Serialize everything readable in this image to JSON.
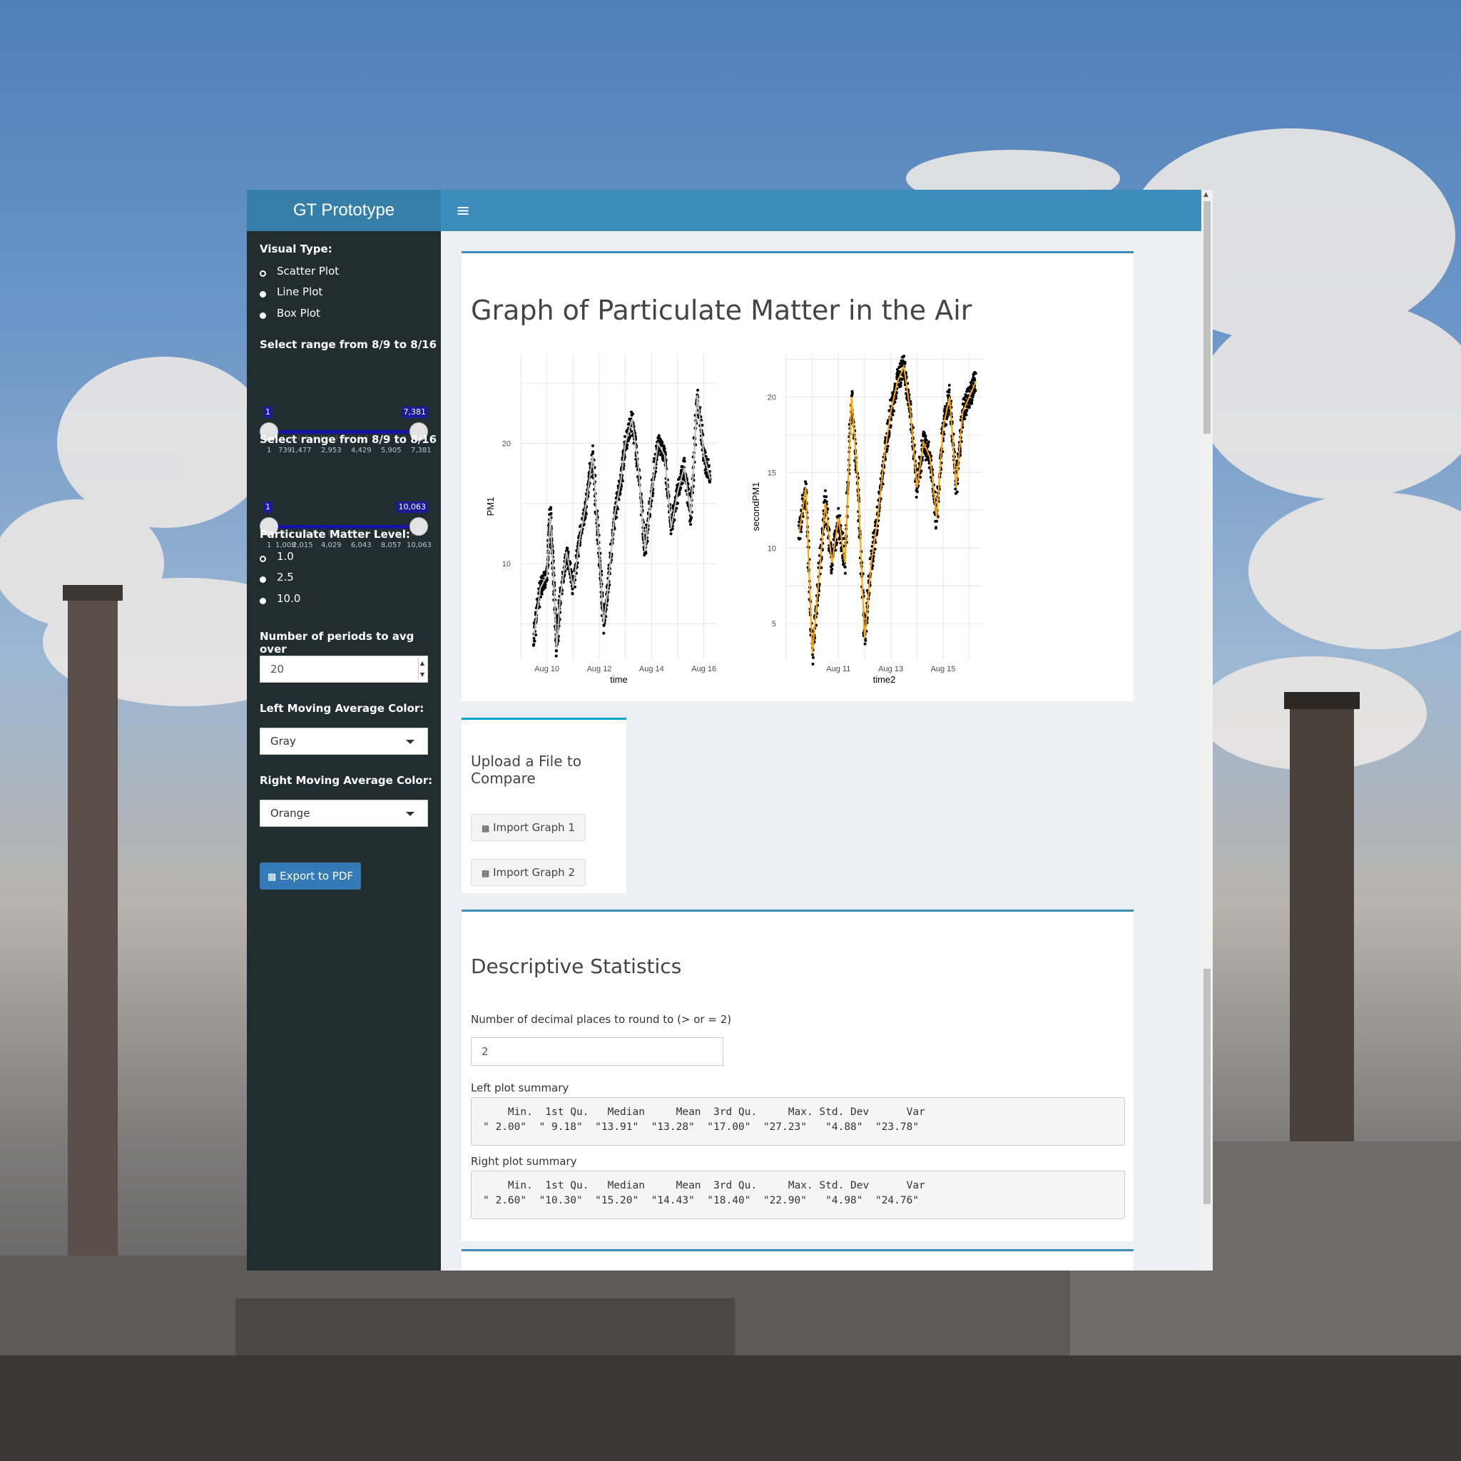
{
  "header": {
    "app_title": "GT Prototype",
    "menu_icon": "hamburger-icon"
  },
  "sidebar": {
    "visual_type": {
      "label": "Visual Type:",
      "options": [
        "Scatter Plot",
        "Line Plot",
        "Box Plot"
      ],
      "selected": "Scatter Plot"
    },
    "range1": {
      "label": "Select range from 8/9 to 8/16",
      "min_value": "1",
      "max_value": "7,381",
      "tick_labels": [
        "1",
        "739",
        "1,477",
        "2,953",
        "4,429",
        "5,905",
        "7,381"
      ]
    },
    "range2": {
      "label": "Select range from 8/9 to 8/16",
      "min_value": "1",
      "max_value": "10,063",
      "tick_labels": [
        "1",
        "1,008",
        "2,015",
        "4,029",
        "6,043",
        "8,057",
        "10,063"
      ]
    },
    "pm_level": {
      "label": "Particulate Matter Level:",
      "options": [
        "1.0",
        "2.5",
        "10.0"
      ],
      "selected": "1.0"
    },
    "periods": {
      "label": "Number of periods to avg over",
      "value": "20"
    },
    "left_color": {
      "label": "Left Moving Average Color:",
      "value": "Gray"
    },
    "right_color": {
      "label": "Right Moving Average Color:",
      "value": "Orange"
    },
    "export_button": "Export to PDF"
  },
  "graph_box": {
    "title": "Graph of Particulate Matter in the Air"
  },
  "chart_data": [
    {
      "type": "scatter",
      "title": "",
      "xlabel": "time",
      "ylabel": "PM1",
      "x_ticks": [
        "Aug 10",
        "Aug 12",
        "Aug 14",
        "Aug 16"
      ],
      "y_ticks": [
        10,
        20
      ],
      "xlim": [
        "2021-08-09",
        "2021-08-16"
      ],
      "ylim": [
        2,
        27.5
      ],
      "grid": true,
      "point_color": "#000000",
      "moving_average_color": "#bebebe",
      "series": [
        {
          "x": [
            "2021-08-09 12:00",
            "2021-08-09 18:00",
            "2021-08-10 00:00",
            "2021-08-10 03:00",
            "2021-08-10 06:00",
            "2021-08-10 09:00",
            "2021-08-10 12:00",
            "2021-08-10 18:00",
            "2021-08-11 00:00",
            "2021-08-11 06:00",
            "2021-08-11 12:00",
            "2021-08-11 18:00",
            "2021-08-12 00:00",
            "2021-08-12 04:00",
            "2021-08-12 08:00",
            "2021-08-12 14:00",
            "2021-08-12 20:00",
            "2021-08-13 00:00",
            "2021-08-13 06:00",
            "2021-08-13 12:00",
            "2021-08-13 18:00",
            "2021-08-14 00:00",
            "2021-08-14 06:00",
            "2021-08-14 12:00",
            "2021-08-14 18:00",
            "2021-08-15 00:00",
            "2021-08-15 06:00",
            "2021-08-15 12:00",
            "2021-08-15 18:00",
            "2021-08-16 00:00",
            "2021-08-16 06:00"
          ],
          "y": [
            4,
            8,
            9,
            14,
            9,
            3,
            7,
            11,
            8,
            12,
            15,
            19,
            11,
            5,
            8,
            14,
            17,
            20,
            22,
            18,
            11,
            16,
            20,
            19,
            13,
            16,
            18,
            14,
            24,
            19,
            17
          ]
        }
      ]
    },
    {
      "type": "scatter",
      "title": "",
      "xlabel": "time2",
      "ylabel": "secondPM1",
      "x_ticks": [
        "Aug 11",
        "Aug 13",
        "Aug 15"
      ],
      "y_ticks": [
        5,
        10,
        15,
        20
      ],
      "xlim": [
        "2021-08-09",
        "2021-08-16"
      ],
      "ylim": [
        2.6,
        22.9
      ],
      "grid": true,
      "point_color": "#000000",
      "moving_average_color": "#ffa500",
      "series": [
        {
          "x": [
            "2021-08-09 12:00",
            "2021-08-09 18:00",
            "2021-08-10 00:00",
            "2021-08-10 06:00",
            "2021-08-10 12:00",
            "2021-08-10 18:00",
            "2021-08-11 00:00",
            "2021-08-11 06:00",
            "2021-08-11 12:00",
            "2021-08-11 18:00",
            "2021-08-12 00:00",
            "2021-08-12 06:00",
            "2021-08-12 12:00",
            "2021-08-12 18:00",
            "2021-08-13 00:00",
            "2021-08-13 06:00",
            "2021-08-13 12:00",
            "2021-08-13 18:00",
            "2021-08-14 00:00",
            "2021-08-14 06:00",
            "2021-08-14 12:00",
            "2021-08-14 18:00",
            "2021-08-15 00:00",
            "2021-08-15 06:00",
            "2021-08-15 12:00",
            "2021-08-15 18:00",
            "2021-08-16 00:00",
            "2021-08-16 06:00"
          ],
          "y": [
            11,
            14,
            3,
            8,
            13,
            9,
            12,
            9,
            20,
            14,
            4,
            9,
            12,
            16,
            19,
            21,
            22,
            19,
            14,
            17,
            16,
            12,
            18,
            20,
            14,
            19,
            20,
            21
          ]
        }
      ]
    }
  ],
  "upload_box": {
    "title": "Upload a File to Compare",
    "import1": "Import Graph 1",
    "import2": "Import Graph 2"
  },
  "stats_box": {
    "title": "Descriptive Statistics",
    "decimal_label": "Number of decimal places to round to (> or = 2)",
    "decimal_value": "2",
    "left_label": "Left plot summary",
    "left_header": "    Min.  1st Qu.   Median     Mean  3rd Qu.     Max. Std. Dev      Var",
    "left_values": "\" 2.00\"  \" 9.18\"  \"13.91\"  \"13.28\"  \"17.00\"  \"27.23\"   \"4.88\"  \"23.78\"",
    "right_label": "Right plot summary",
    "right_header": "    Min.  1st Qu.   Median     Mean  3rd Qu.     Max. Std. Dev      Var",
    "right_values": "\" 2.60\"  \"10.30\"  \"15.20\"  \"14.43\"  \"18.40\"  \"22.90\"   \"4.98\"  \"24.76\""
  }
}
